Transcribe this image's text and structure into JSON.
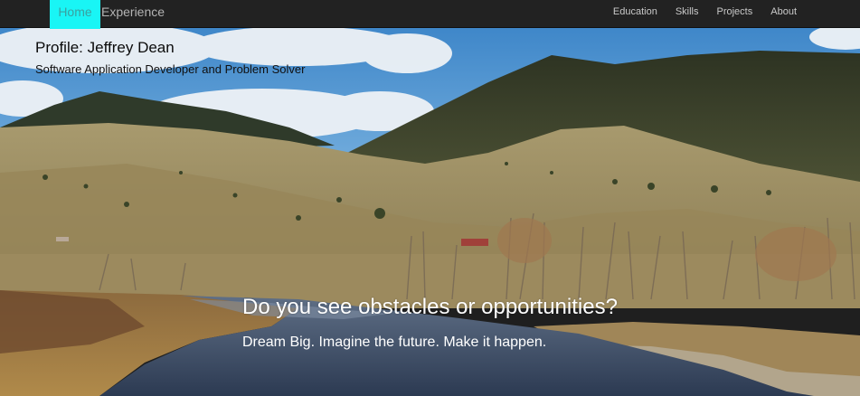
{
  "nav": {
    "home_label": "Home",
    "brand_label": "Experience",
    "links": [
      {
        "label": "Education"
      },
      {
        "label": "Skills"
      },
      {
        "label": "Projects"
      },
      {
        "label": "About"
      }
    ]
  },
  "profile": {
    "title": "Profile: Jeffrey Dean",
    "subtitle": "Software Application Developer and Problem Solver"
  },
  "hero": {
    "headline": "Do you see obstacles or opportunities?",
    "tagline": "Dream Big. Imagine the future. Make it happen."
  },
  "colors": {
    "navbar_bg": "#222222",
    "home_highlight": "#19f5f5",
    "nav_text": "#c9c9c9"
  }
}
